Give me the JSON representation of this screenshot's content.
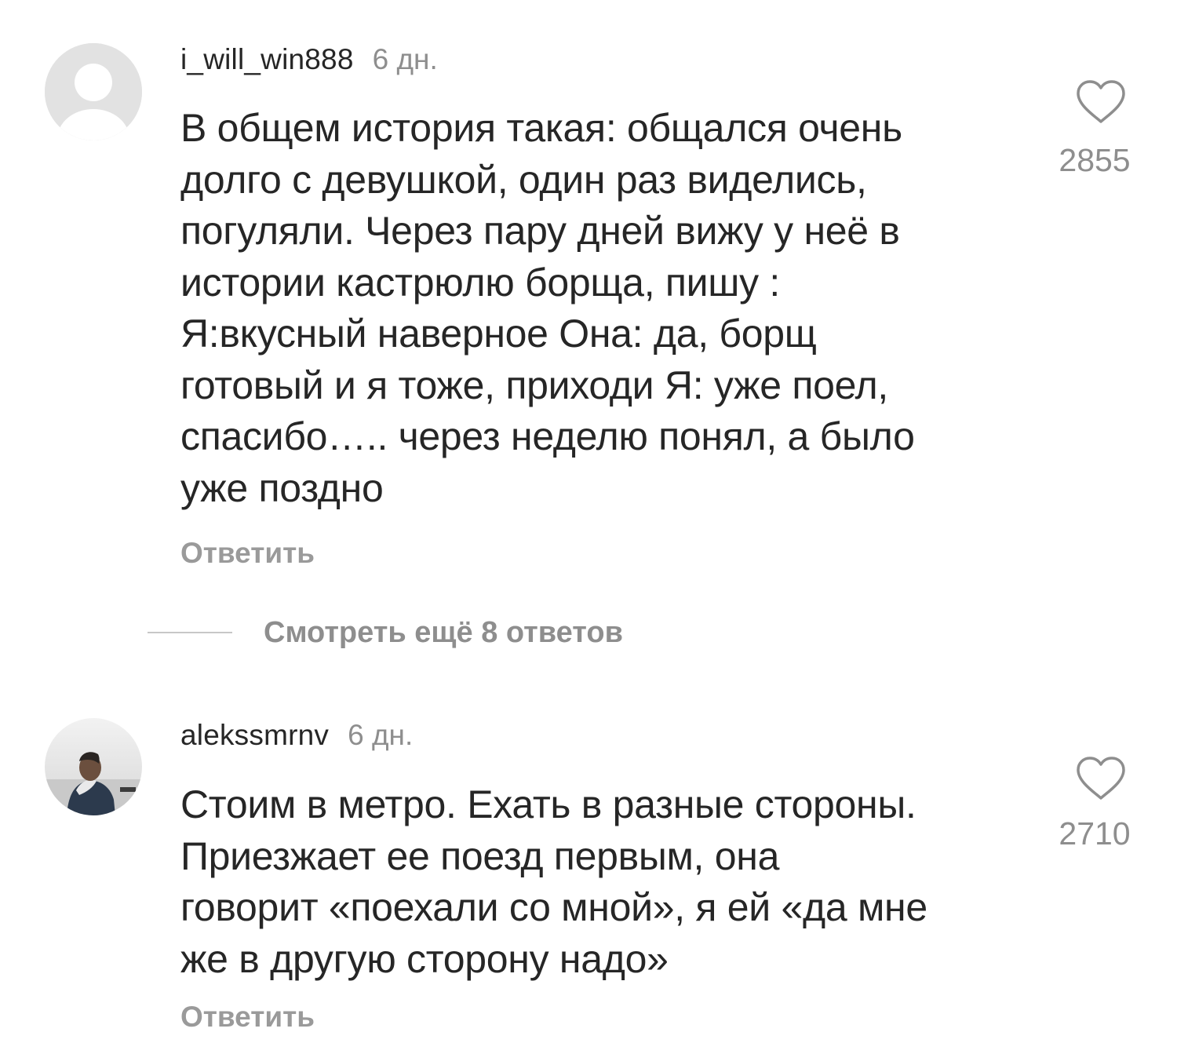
{
  "comments": [
    {
      "username": "i_will_win888",
      "time": "6 дн.",
      "lines": [
        "В общем история такая: общался очень",
        "долго с девушкой, один раз виделись,",
        "погуляли. Через пару дней вижу у неё в",
        "истории кастрюлю борща, пишу :",
        "Я:вкусный наверное  Она: да, борщ",
        "готовый и я тоже, приходи  Я: уже поел,",
        "спасибо….. через неделю понял, а было",
        "уже поздно"
      ],
      "likes": "2855",
      "reply_label": "Ответить",
      "avatar": "default-avatar-icon"
    },
    {
      "username": "alekssmrnv",
      "time": "6 дн.",
      "lines": [
        "Стоим в метро. Ехать в разные стороны.",
        "Приезжает ее поезд первым, она",
        "говорит «поехали со мной», я ей «да мне",
        "же в другую сторону надо»"
      ],
      "likes": "2710",
      "reply_label": "Ответить",
      "avatar": "user-photo-avatar"
    }
  ],
  "view_replies": {
    "label": "Смотреть ещё 8 ответов"
  },
  "icons": {
    "like": "heart-outline-icon"
  },
  "colors": {
    "text_primary": "#262626",
    "text_secondary": "#8e8e8e",
    "background": "#ffffff"
  }
}
